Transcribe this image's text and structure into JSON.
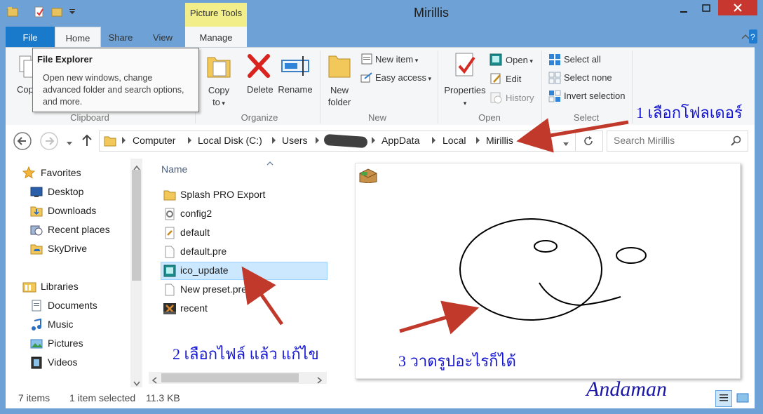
{
  "window": {
    "title": "Mirillis",
    "context_tab": "Picture Tools"
  },
  "tabs": [
    "File",
    "Home",
    "Share",
    "View",
    "Manage"
  ],
  "ribbon": {
    "clipboard": {
      "copy_label": "Cop",
      "group_label": "Clipboard"
    },
    "organize": {
      "copy_to": [
        "Copy",
        "to"
      ],
      "delete": "Delete",
      "rename": "Rename",
      "group_label": "Organize"
    },
    "new": {
      "new_folder": [
        "New",
        "folder"
      ],
      "new_item": "New item",
      "easy_access": "Easy access",
      "group_label": "New"
    },
    "open": {
      "properties": "Properties",
      "open": "Open",
      "edit": "Edit",
      "history": "History",
      "group_label": "Open"
    },
    "select": {
      "select_all": "Select all",
      "select_none": "Select none",
      "invert_selection": "Invert selection",
      "group_label": "Select"
    }
  },
  "tooltip": {
    "title": "File Explorer",
    "body": "Open new windows, change advanced folder and search options, and more."
  },
  "address": {
    "crumbs": [
      "Computer",
      "Local Disk (C:)",
      "Users",
      "AppData",
      "Local",
      "Mirillis"
    ]
  },
  "search": {
    "placeholder": "Search Mirillis"
  },
  "navpane": {
    "favorites": {
      "label": "Favorites",
      "items": [
        "Desktop",
        "Downloads",
        "Recent places",
        "SkyDrive"
      ]
    },
    "libraries": {
      "label": "Libraries",
      "items": [
        "Documents",
        "Music",
        "Pictures",
        "Videos"
      ]
    }
  },
  "filelist": {
    "column": "Name",
    "items": [
      {
        "name": "Splash PRO Export",
        "icon": "folder-icon",
        "selected": false
      },
      {
        "name": "config2",
        "icon": "settings-file-icon",
        "selected": false
      },
      {
        "name": "default",
        "icon": "config-file-icon",
        "selected": false
      },
      {
        "name": "default.pre",
        "icon": "blank-file-icon",
        "selected": false
      },
      {
        "name": "ico_update",
        "icon": "image-file-icon",
        "selected": true
      },
      {
        "name": "New preset.pre",
        "icon": "blank-file-icon",
        "selected": false
      },
      {
        "name": "recent",
        "icon": "dat-file-icon",
        "selected": false
      }
    ]
  },
  "status": {
    "items_count": "7 items",
    "selected": "1 item selected",
    "size": "11.3 KB"
  },
  "annotations": {
    "step1": "1 เลือกโฟลเดอร์",
    "step2": "2 เลือกไฟล์ แล้ว แก้ไข",
    "step3": "3 วาดรูปอะไรก็ได้",
    "signature": "Andaman"
  },
  "colors": {
    "title_bar": "#6ea2d6",
    "file_tab": "#1979ca",
    "context_tab": "#f2ee8a",
    "selection": "#cce8ff",
    "annotation_arrow": "#c0392b",
    "annotation_text": "#1616d2"
  }
}
